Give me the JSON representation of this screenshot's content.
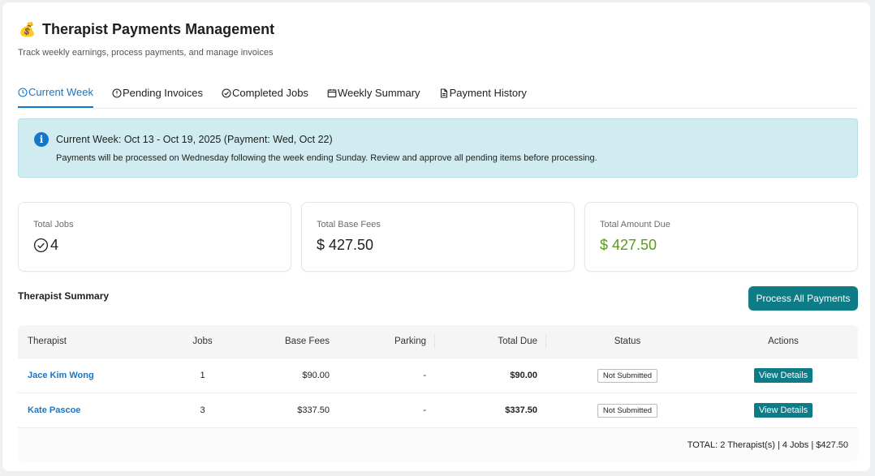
{
  "header": {
    "icon": "money-bag-icon",
    "title": "Therapist Payments Management",
    "subtitle": "Track weekly earnings, process payments, and manage invoices"
  },
  "tabs": [
    {
      "label": "Current Week",
      "icon": "clock-icon",
      "active": true
    },
    {
      "label": "Pending Invoices",
      "icon": "alert-circle-icon",
      "active": false
    },
    {
      "label": "Completed Jobs",
      "icon": "check-circle-icon",
      "active": false
    },
    {
      "label": "Weekly Summary",
      "icon": "calendar-icon",
      "active": false
    },
    {
      "label": "Payment History",
      "icon": "document-icon",
      "active": false
    }
  ],
  "alert": {
    "icon_text": "i",
    "heading": "Current Week: Oct 13 - Oct 19, 2025 (Payment: Wed, Oct 22)",
    "body": "Payments will be processed on Wednesday following the week ending Sunday. Review and approve all pending items before processing."
  },
  "stats": [
    {
      "label": "Total Jobs",
      "value": "4"
    },
    {
      "label": "Total Base Fees",
      "value": "$ 427.50"
    },
    {
      "label": "Total Amount Due",
      "value": "$ 427.50"
    }
  ],
  "summary": {
    "title": "Therapist Summary",
    "process_label": "Process All Payments",
    "columns": {
      "therapist": "Therapist",
      "jobs": "Jobs",
      "base_fees": "Base Fees",
      "parking": "Parking",
      "total_due": "Total Due",
      "status": "Status",
      "actions": "Actions"
    },
    "rows": [
      {
        "name": "Jace Kim Wong",
        "jobs": "1",
        "base_fees": "$90.00",
        "parking": "-",
        "total_due": "$90.00",
        "status": "Not Submitted",
        "action": "View Details"
      },
      {
        "name": "Kate Pascoe",
        "jobs": "3",
        "base_fees": "$337.50",
        "parking": "-",
        "total_due": "$337.50",
        "status": "Not Submitted",
        "action": "View Details"
      }
    ],
    "footer": "TOTAL: 2 Therapist(s) | 4 Jobs | $427.50"
  },
  "colors": {
    "accent": "#1677c8",
    "primary_button": "#0e7c86",
    "alert_bg": "#d1ecf1",
    "amount_due": "#5b9a1a"
  }
}
